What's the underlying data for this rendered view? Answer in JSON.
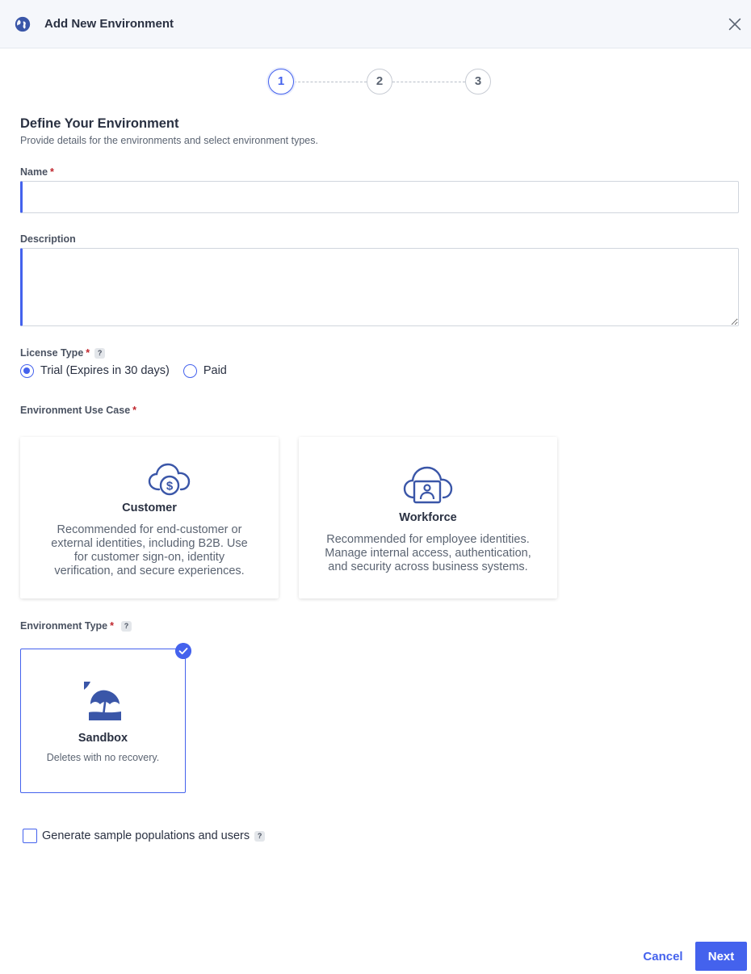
{
  "header": {
    "title": "Add New Environment",
    "icon": "globe-icon",
    "close_icon": "close-icon"
  },
  "stepper": {
    "steps": [
      "1",
      "2",
      "3"
    ],
    "active": 1
  },
  "section": {
    "title": "Define Your Environment",
    "subtitle": "Provide details for the environments and select environment types."
  },
  "fields": {
    "name": {
      "label": "Name",
      "required": "*",
      "value": "",
      "placeholder": ""
    },
    "description": {
      "label": "Description",
      "value": "",
      "placeholder": ""
    }
  },
  "license_type": {
    "label": "License Type",
    "required": "*",
    "help": "?",
    "options": [
      {
        "label": "Trial (Expires in 30 days)",
        "checked": true
      },
      {
        "label": "Paid",
        "checked": false
      }
    ]
  },
  "use_case": {
    "label": "Environment Use Case",
    "required": "*",
    "cards": [
      {
        "title": "Customer",
        "icon": "cloud-dollar-icon",
        "description": "Recommended for end-customer or external identities, including B2B. Use for customer sign-on, identity verification, and secure experiences."
      },
      {
        "title": "Workforce",
        "icon": "cloud-badge-icon",
        "description": "Recommended for employee identities. Manage internal access, authentication, and security across business systems."
      }
    ]
  },
  "environment_type": {
    "label": "Environment Type",
    "required": "*",
    "help": "?",
    "card": {
      "title": "Sandbox",
      "icon": "beach-umbrella-icon",
      "description": "Deletes with no recovery.",
      "selected": true
    }
  },
  "sample_data": {
    "label": "Generate sample populations and users",
    "help": "?",
    "checked": false
  },
  "footer": {
    "cancel_label": "Cancel",
    "next_label": "Next"
  },
  "colors": {
    "accent": "#4462ed",
    "required": "#c0262d",
    "header_bg": "#f5f7fb",
    "icon": "#3a56a8"
  }
}
